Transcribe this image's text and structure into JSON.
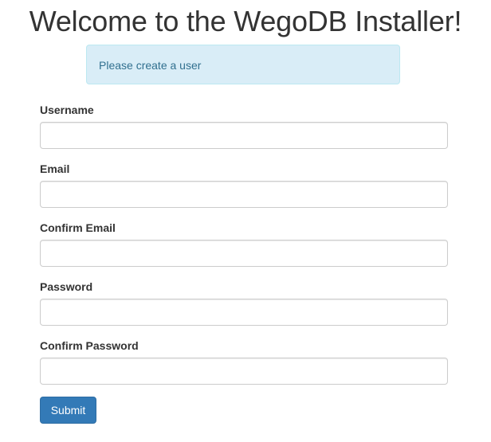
{
  "page": {
    "title": "Welcome to the WegoDB Installer!"
  },
  "alert": {
    "message": "Please create a user"
  },
  "form": {
    "fields": [
      {
        "label": "Username",
        "value": "",
        "placeholder": ""
      },
      {
        "label": "Email",
        "value": "",
        "placeholder": ""
      },
      {
        "label": "Confirm Email",
        "value": "",
        "placeholder": ""
      },
      {
        "label": "Password",
        "value": "",
        "placeholder": ""
      },
      {
        "label": "Confirm Password",
        "value": "",
        "placeholder": ""
      }
    ],
    "submit_label": "Submit"
  },
  "colors": {
    "alert_background": "#d9edf7",
    "alert_text": "#31708f",
    "primary_button": "#337ab7"
  }
}
